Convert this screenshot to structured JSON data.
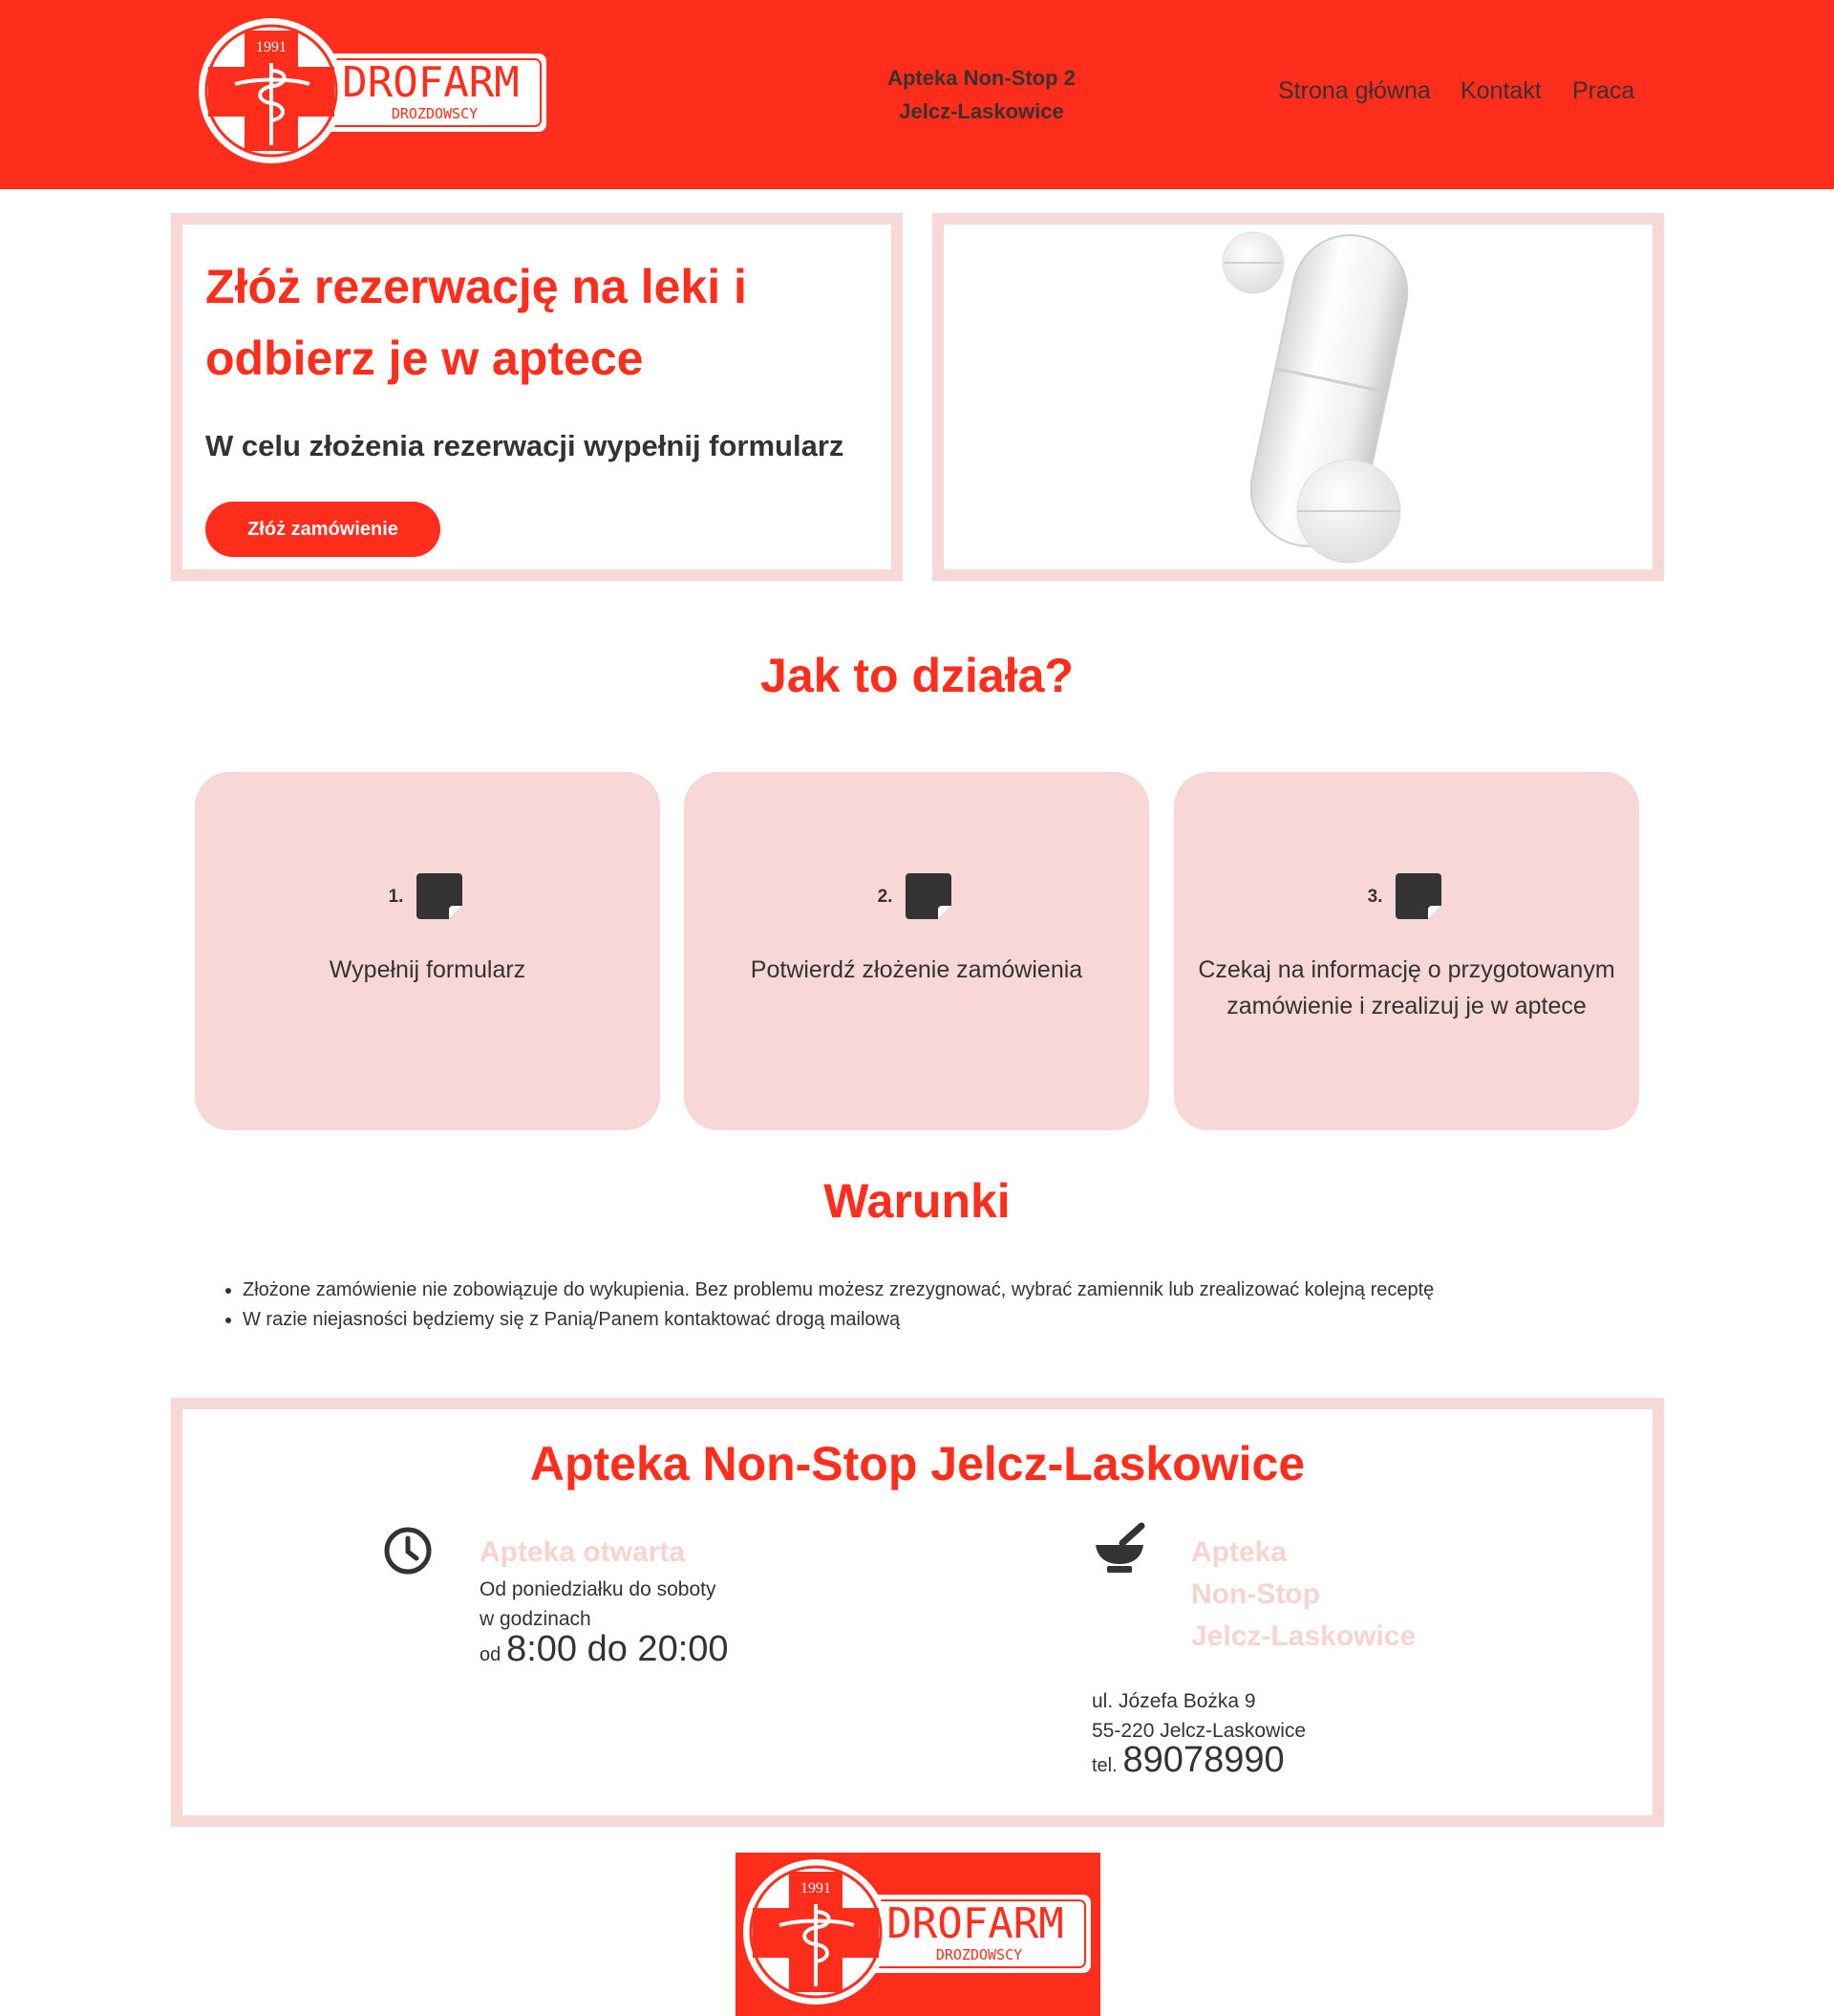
{
  "brand": {
    "logo_year": "1991",
    "logo_name": "DROFARM",
    "logo_sub": "DROZDOWSCY",
    "primary_color": "#ff2d1c",
    "accent_pink": "#f7d8d6"
  },
  "header": {
    "title_line1": "Apteka Non-Stop 2",
    "title_line2": "Jelcz-Laskowice",
    "nav": [
      "Strona główna",
      "Kontakt",
      "Praca"
    ]
  },
  "hero": {
    "title": "Złóż rezerwację na leki i odbierz je w aptece",
    "subtitle": "W celu złożenia rezerwacji wypełnij formularz",
    "button_label": "Złóż zamówienie"
  },
  "how": {
    "title": "Jak to działa?",
    "steps": [
      {
        "num": "1.",
        "icon": "note-icon",
        "text": "Wypełnij formularz"
      },
      {
        "num": "2.",
        "icon": "note-icon",
        "text": "Potwierdź złożenie zamówienia"
      },
      {
        "num": "3.",
        "icon": "note-icon",
        "text": "Czekaj na informację o przygotowanym zamówienie i zrealizuj je w aptece"
      }
    ]
  },
  "conditions": {
    "title": "Warunki",
    "items": [
      "Złożone zamówienie nie zobowiązuje do wykupienia. Bez problemu możesz zrezygnować, wybrać zamiennik lub zrealizować kolejną receptę",
      "W razie niejasności będziemy się z Panią/Panem kontaktować drogą mailową"
    ]
  },
  "info": {
    "title": "Apteka Non-Stop Jelcz-Laskowice",
    "hours": {
      "icon": "clock-icon",
      "heading": "Apteka otwarta",
      "line1": "Od poniedziałku do soboty",
      "line2": "w godzinach",
      "prefix": "od",
      "time": "8:00 do 20:00"
    },
    "pharmacy": {
      "icon": "mortar-pestle-icon",
      "heading_line1": "Apteka",
      "heading_line2": "Non-Stop",
      "heading_line3": "Jelcz-Laskowice",
      "street": "ul. Józefa Bożka 9",
      "city": "55-220 Jelcz-Laskowice",
      "tel_prefix": "tel.",
      "tel": "89078990"
    }
  }
}
